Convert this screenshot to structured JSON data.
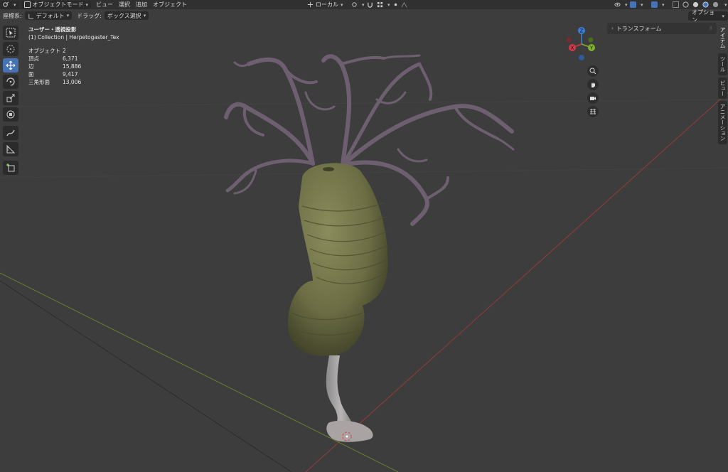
{
  "header": {
    "mode_label": "オブジェクトモード",
    "menu": [
      "ビュー",
      "選択",
      "追加",
      "オブジェクト"
    ],
    "transform_orientation": "ローカル"
  },
  "subheader": {
    "coord_label": "座標系:",
    "coord_value": "デフォルト",
    "drag_label": "ドラッグ:",
    "drag_value": "ボックス選択",
    "options_label": "オプション"
  },
  "viewport": {
    "view_name": "ユーザー・透視投影",
    "collection": "(1) Collection | Herpetogaster_Tex",
    "stats": [
      {
        "label": "オブジェクト",
        "value": "2"
      },
      {
        "label": "頂点",
        "value": "6,371"
      },
      {
        "label": "辺",
        "value": "15,886"
      },
      {
        "label": "面",
        "value": "9,417"
      },
      {
        "label": "三角形面",
        "value": "13,006"
      }
    ],
    "axis_colors": {
      "x": "#d63a4a",
      "y": "#7fb32b",
      "z": "#3d7fd6"
    },
    "gizmo_labels": {
      "x": "X",
      "y": "Y",
      "z": "Z"
    }
  },
  "npanel": {
    "transform_label": "トランスフォーム",
    "tabs": [
      "アイテム",
      "ツール",
      "ビュー",
      "アニメーション"
    ]
  },
  "icons": {
    "tools": [
      "select-box-icon",
      "cursor-icon",
      "move-icon",
      "rotate-icon",
      "scale-icon",
      "transform-icon",
      "annotate-icon",
      "measure-icon",
      "add-cube-icon"
    ],
    "nav": [
      "zoom-icon",
      "hand-icon",
      "camera-icon",
      "grid-icon"
    ]
  }
}
